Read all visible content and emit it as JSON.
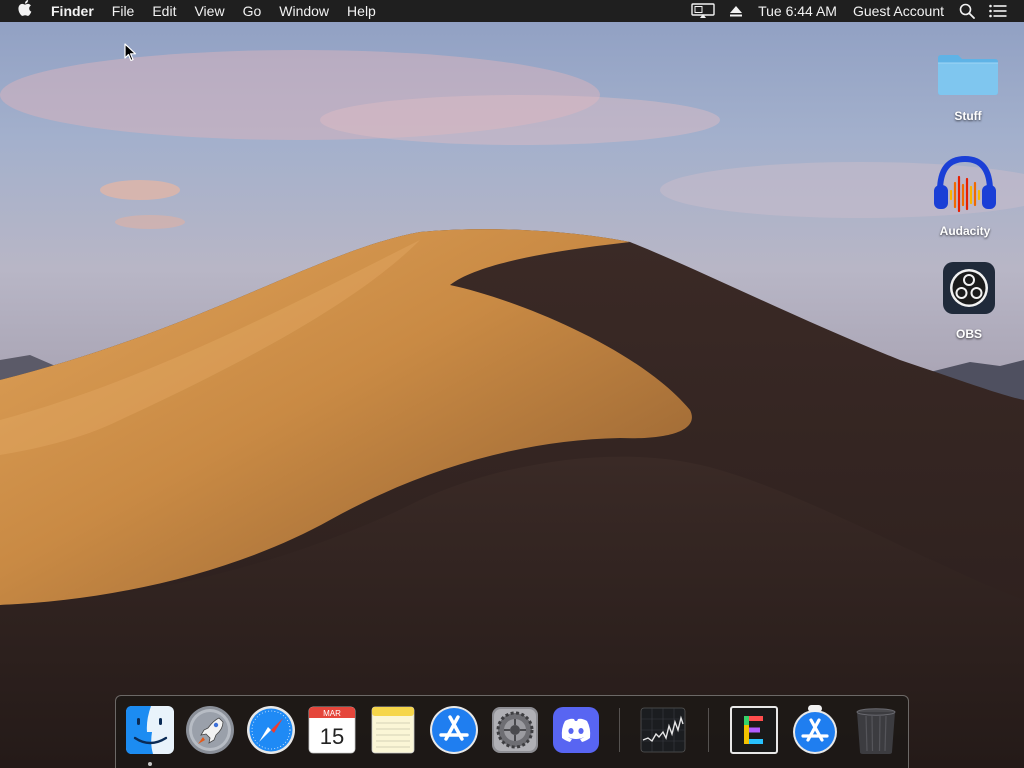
{
  "menubar": {
    "apple_icon": "apple-logo-icon",
    "app_name": "Finder",
    "menus": [
      "File",
      "Edit",
      "View",
      "Go",
      "Window",
      "Help"
    ],
    "status": {
      "airplay_icon": "airplay-display-icon",
      "eject_icon": "eject-icon",
      "clock": "Tue 6:44 AM",
      "user": "Guest Account",
      "spotlight_icon": "spotlight-search-icon",
      "notification_icon": "notification-center-icon"
    }
  },
  "desktop": {
    "icons": [
      {
        "label": "Stuff",
        "icon": "folder-icon"
      },
      {
        "label": "Audacity",
        "icon": "audacity-icon"
      },
      {
        "label": "OBS",
        "icon": "obs-icon"
      }
    ]
  },
  "dock": {
    "apps": [
      {
        "name": "Finder",
        "icon": "finder-icon",
        "running": true
      },
      {
        "name": "Launchpad",
        "icon": "launchpad-icon",
        "running": false
      },
      {
        "name": "Safari",
        "icon": "safari-icon",
        "running": false
      },
      {
        "name": "Calendar",
        "icon": "calendar-icon",
        "running": false,
        "month": "MAR",
        "day": "15"
      },
      {
        "name": "Notes",
        "icon": "notes-icon",
        "running": false
      },
      {
        "name": "App Store",
        "icon": "app-store-icon",
        "running": false
      },
      {
        "name": "System Preferences",
        "icon": "system-preferences-icon",
        "running": false
      },
      {
        "name": "Discord",
        "icon": "discord-icon",
        "running": false
      }
    ],
    "others": [
      {
        "name": "Stocks",
        "icon": "stocks-chart-icon"
      },
      {
        "name": "Editor",
        "icon": "editor-e-icon"
      },
      {
        "name": "App Store Installer",
        "icon": "app-store-installer-icon"
      },
      {
        "name": "Trash",
        "icon": "trash-icon"
      }
    ]
  },
  "colors": {
    "menubar_bg": "#1f1f1f",
    "accent_blue": "#1f7ef0",
    "discord": "#5865f2"
  }
}
